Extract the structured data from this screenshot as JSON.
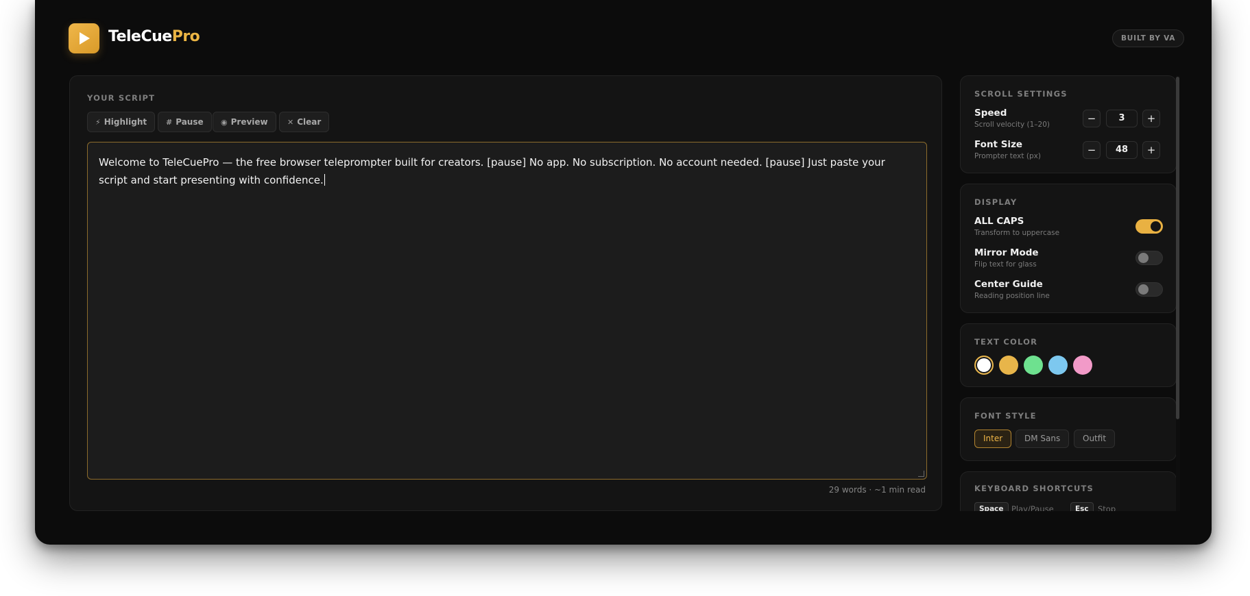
{
  "app": {
    "brand_main": "TeleCue",
    "brand_accent": "Pro",
    "built_by": "BUILT BY VA",
    "accent_color": "#ebb544"
  },
  "script": {
    "label": "YOUR SCRIPT",
    "toolbar": {
      "highlight": "Highlight",
      "pause": "Pause",
      "preview": "Preview",
      "clear": "Clear"
    },
    "text": "Welcome to TeleCuePro — the free browser teleprompter built for creators. [pause] No app. No subscription. No account needed. [pause] Just paste your script and start presenting with confidence.",
    "word_count": "29 words · ~1 min read"
  },
  "scroll_settings": {
    "label": "SCROLL SETTINGS",
    "speed": {
      "title": "Speed",
      "sub": "Scroll velocity (1–20)",
      "value": "3"
    },
    "font_size": {
      "title": "Font Size",
      "sub": "Prompter text (px)",
      "value": "48"
    },
    "minus": "−",
    "plus": "+"
  },
  "display": {
    "label": "DISPLAY",
    "all_caps": {
      "title": "ALL CAPS",
      "sub": "Transform to uppercase",
      "on": true
    },
    "mirror": {
      "title": "Mirror Mode",
      "sub": "Flip text for glass",
      "on": false
    },
    "guide": {
      "title": "Center Guide",
      "sub": "Reading position line",
      "on": false
    }
  },
  "text_color": {
    "label": "TEXT COLOR",
    "swatches": [
      "#ffffff",
      "#e8b54a",
      "#6ee18f",
      "#7dc8ef",
      "#f29ac8"
    ],
    "selected": "#ffffff"
  },
  "font_style": {
    "label": "FONT STYLE",
    "options": [
      "Inter",
      "DM Sans",
      "Outfit"
    ],
    "selected": "Inter"
  },
  "shortcuts": {
    "label": "KEYBOARD SHORTCUTS",
    "items": [
      {
        "key": "Space",
        "action": "Play/Pause"
      },
      {
        "key": "Esc",
        "action": "Stop"
      }
    ]
  }
}
